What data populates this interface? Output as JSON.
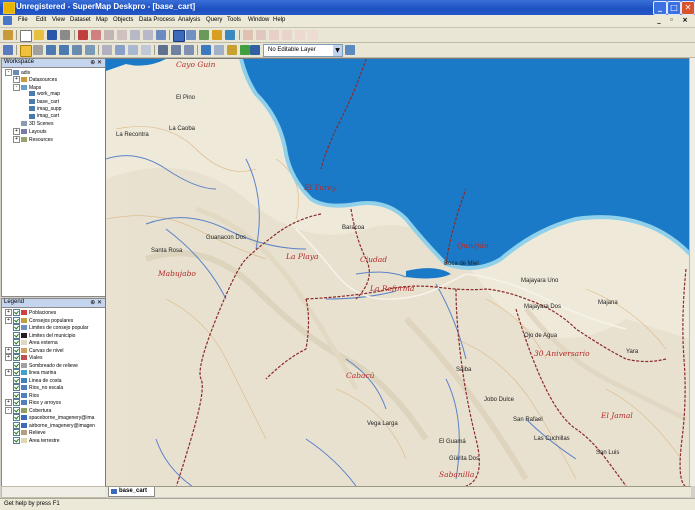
{
  "window": {
    "title": "Unregistered - SuperMap Deskpro - [base_cart]",
    "controls": [
      "_",
      "□",
      "✕"
    ]
  },
  "menubar": {
    "items": [
      "File",
      "Edit",
      "View",
      "Dataset",
      "Map",
      "Objects",
      "Data Process",
      "Analysis",
      "Query",
      "Tools",
      "Window",
      "Help"
    ],
    "mdi_controls": "_ ◦ ×"
  },
  "toolbar": {
    "layer_select_value": "No Editable Layer"
  },
  "workspace": {
    "title": "Workspace",
    "pin": "⊕ ✕",
    "items": [
      {
        "label": "adis",
        "level": 0,
        "exp": "-"
      },
      {
        "label": "Datasources",
        "level": 1,
        "exp": "+"
      },
      {
        "label": "Maps",
        "level": 1,
        "exp": "-"
      },
      {
        "label": "work_map",
        "level": 2,
        "exp": ""
      },
      {
        "label": "base_cart",
        "level": 2,
        "exp": ""
      },
      {
        "label": "imag_supp",
        "level": 2,
        "exp": ""
      },
      {
        "label": "imag_cart",
        "level": 2,
        "exp": ""
      },
      {
        "label": "3D Scenes",
        "level": 1,
        "exp": ""
      },
      {
        "label": "Layouts",
        "level": 1,
        "exp": "+"
      },
      {
        "label": "Resources",
        "level": 1,
        "exp": "+"
      }
    ]
  },
  "legend": {
    "title": "Legend",
    "pin": "⊕ ✕",
    "items": [
      {
        "label": "Poblaciones",
        "exp": "+"
      },
      {
        "label": "Consejos populares",
        "exp": "+"
      },
      {
        "label": "Limites de consejo popular",
        "exp": ""
      },
      {
        "label": "Limites del municipio",
        "exp": ""
      },
      {
        "label": "Area externa",
        "exp": ""
      },
      {
        "label": "Curvas de nivel",
        "exp": "+"
      },
      {
        "label": "Viales",
        "exp": "+"
      },
      {
        "label": "Sombreado de relieve",
        "exp": ""
      },
      {
        "label": "linea marina",
        "exp": "+"
      },
      {
        "label": "Linea de costa",
        "exp": ""
      },
      {
        "label": "Rios_no escala",
        "exp": ""
      },
      {
        "label": "Rios",
        "exp": ""
      },
      {
        "label": "Rios y arroyos",
        "exp": "+"
      },
      {
        "label": "Cobertura",
        "exp": "-"
      },
      {
        "label": "spaceborne_imagenery@ima",
        "exp": ""
      },
      {
        "label": "airborne_imagenery@imagen",
        "exp": ""
      },
      {
        "label": "Relieve",
        "exp": ""
      },
      {
        "label": "Area terrestre",
        "exp": ""
      }
    ]
  },
  "map": {
    "places": [
      {
        "name": "Cayo Guin",
        "kind": "region"
      },
      {
        "name": "El Pino",
        "kind": "town"
      },
      {
        "name": "La Caoba",
        "kind": "town"
      },
      {
        "name": "La Recontra",
        "kind": "town"
      },
      {
        "name": "El Turey",
        "kind": "region"
      },
      {
        "name": "Baracoa",
        "kind": "town"
      },
      {
        "name": "Guanacon Dos",
        "kind": "town"
      },
      {
        "name": "Santa Rosa",
        "kind": "town"
      },
      {
        "name": "Mabujabo",
        "kind": "region"
      },
      {
        "name": "La Playa",
        "kind": "region"
      },
      {
        "name": "Ciudad",
        "kind": "region"
      },
      {
        "name": "La Reforma",
        "kind": "region"
      },
      {
        "name": "Quiviján",
        "kind": "region"
      },
      {
        "name": "Boca de Miel",
        "kind": "town"
      },
      {
        "name": "Majayara Uno",
        "kind": "town"
      },
      {
        "name": "Majayara Dos",
        "kind": "town"
      },
      {
        "name": "Majana",
        "kind": "town"
      },
      {
        "name": "Ojo de Agua",
        "kind": "town"
      },
      {
        "name": "30 Aniversario",
        "kind": "region"
      },
      {
        "name": "Yara",
        "kind": "town"
      },
      {
        "name": "Cabacú",
        "kind": "region"
      },
      {
        "name": "Saiba",
        "kind": "town"
      },
      {
        "name": "Jobo Dulce",
        "kind": "town"
      },
      {
        "name": "San Rafael",
        "kind": "town"
      },
      {
        "name": "El Jamal",
        "kind": "region"
      },
      {
        "name": "Vega Larga",
        "kind": "town"
      },
      {
        "name": "El Guamá",
        "kind": "town"
      },
      {
        "name": "Las Cuchillas",
        "kind": "town"
      },
      {
        "name": "San Luis",
        "kind": "town"
      },
      {
        "name": "Güirita Dos",
        "kind": "town"
      },
      {
        "name": "Sabanilla",
        "kind": "region"
      }
    ]
  },
  "tab": {
    "label": "base_cart"
  },
  "status": {
    "text": "Get help by press F1"
  },
  "colors": {
    "sea": "#1a7ac8",
    "land": "#efe9da",
    "boundary": "#8b2a2a",
    "river": "#5b82c8",
    "titlebar": "#1c4fbf"
  }
}
